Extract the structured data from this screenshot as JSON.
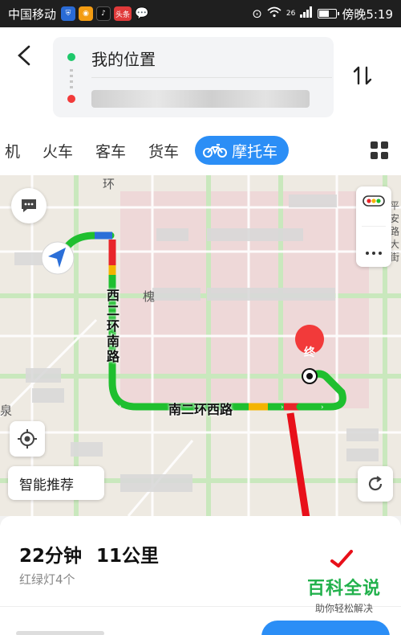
{
  "status_bar": {
    "carrier": "中国移动",
    "app_icon_badge": "头条",
    "network": "26",
    "time": "傍晚5:19",
    "icons": [
      "shield-icon",
      "camera-icon",
      "tiktok-icon",
      "toutiao-icon",
      "chat-icon",
      "location-icon",
      "wifi-icon",
      "signal-icon",
      "battery-icon"
    ]
  },
  "route": {
    "from": "我的位置"
  },
  "tabs": [
    {
      "label": "机",
      "partial": true
    },
    {
      "label": "火车"
    },
    {
      "label": "客车"
    },
    {
      "label": "货车"
    },
    {
      "label": "摩托车",
      "active": true
    }
  ],
  "map": {
    "roads": {
      "west_ring": "西二环南路",
      "south_ring": "南二环西路",
      "top_fragment": "环",
      "mid_fragment": "槐",
      "left_fragment": "泉",
      "right_fragment": "平安路大街"
    },
    "end_marker": "终",
    "smart_button": "智能推荐",
    "route_colors": {
      "green": "#1fbf2f",
      "yellow": "#f4b400",
      "red": "#e8252a",
      "blue": "#2b6fd8"
    }
  },
  "summary": {
    "duration": "22分钟",
    "distance": "11公里",
    "traffic_lights": "红绿灯4个"
  },
  "watermark": {
    "title": "百科全说",
    "subtitle": "助你轻松解决"
  },
  "colors": {
    "accent": "#2b8ef6",
    "start_green": "#1ec86b",
    "end_red": "#f23a3a"
  }
}
